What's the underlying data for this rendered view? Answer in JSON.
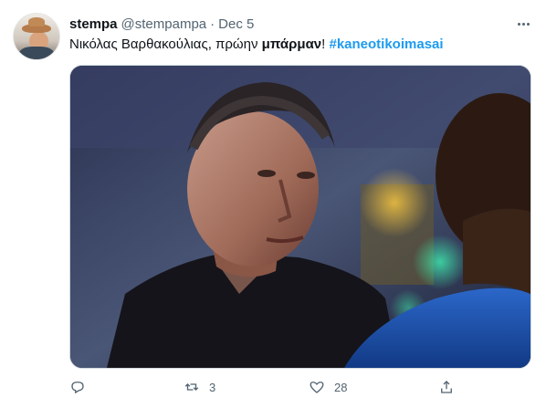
{
  "tweet": {
    "display_name": "stempa",
    "handle": "@stempampa",
    "separator": "·",
    "date": "Dec 5",
    "text": {
      "part1": "Νικόλας Βαρθακούλιας, πρώην ",
      "bold_word": "μπάρμαν",
      "exclamation": "!",
      "hashtag": "#kaneotikoimasai"
    },
    "media": {
      "description_alt": "image"
    },
    "actions": {
      "reply": {
        "icon": "reply-icon"
      },
      "retweet": {
        "icon": "retweet-icon",
        "count": "3"
      },
      "like": {
        "icon": "heart-icon",
        "count": "28"
      },
      "share": {
        "icon": "share-icon"
      }
    },
    "colors": {
      "accent": "#1d9bf0",
      "secondary_text": "#536471",
      "primary_text": "#0f1419"
    }
  }
}
